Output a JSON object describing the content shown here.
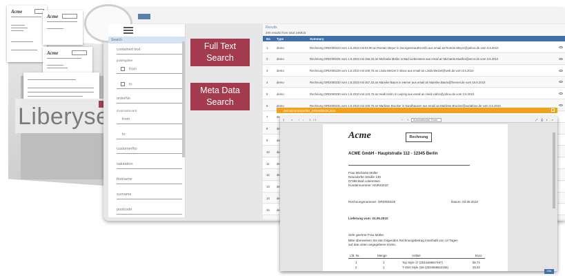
{
  "brand": {
    "name": "Liberyse"
  },
  "background_docs": {
    "logo": "Acme",
    "header_text": "ACME GmbH - Hauptstraße 112 - 12345 Berlin"
  },
  "sidebar": {
    "search_label": "Search",
    "fields": {
      "contained_text": "contained text",
      "postingdate": "postingdate",
      "from": "from",
      "to": "to",
      "orderNo": "orderNo",
      "invoiceamount": "invoiceamount",
      "amount_from": "from",
      "amount_to": "to",
      "customerNo": "customerNo",
      "salutation": "salutation",
      "firstname": "firstname",
      "surname": "surname",
      "postcode": "postcode"
    }
  },
  "labels": {
    "full_text": [
      "Full Text",
      "Search"
    ],
    "meta_data": [
      "Meta Data",
      "Search"
    ]
  },
  "results": {
    "title": "Results",
    "count_text": "200 results from total 246815",
    "columns": {
      "no": "No",
      "type": "Type",
      "summary": "Summary"
    },
    "rows": [
      {
        "no": "1",
        "type": "demo",
        "summary": "Rechnung ORD000223 vom 1.5.2010 mit 53,90 an Roman Meyer in Georgensraut/Hombi aus email an Roman.Meyer@yahoo.de vom 3.5.2010"
      },
      {
        "no": "2",
        "type": "demo",
        "summary": "Rechnung ORD000225 vom 1.5.2010 mit 156,32 an Michaela Müller in Bad Liebenstein aus email an Michaela.Mueller@arcor.de vom 3.5.2010"
      },
      {
        "no": "3",
        "type": "demo",
        "summary": "Rechnung ORD000229 vom 1.5.2010 mit 100,75 an Linda Wetzel in Bous aus email an Linda.Wetzel@web.de vom 3.5.2010"
      },
      {
        "no": "4",
        "type": "demo",
        "summary": "Rechnung ORD000233 vom 1.5.2010 mit 457,33 an Mareike Baum in Hemer aus email an Mareike.Baum@freenet.de vom 15.8.2010"
      },
      {
        "no": "5",
        "type": "demo",
        "summary": "Rechnung ORD000230 vom 1.5.2010 mit 143,75 an Heidi Hahn in Leipzig aus email an Heidi.Hahn@yahoo.de vom 3.5.2010"
      },
      {
        "no": "6",
        "type": "demo",
        "summary": "Rechnung ORD000231 vom 1.5.2010 mit 100,75 an Marliese Brucker in Sandhausen aus email an Marliese.Brucker@vodafone.de vom 3.5.2010"
      },
      {
        "no": "7",
        "type": "dem",
        "summary": ""
      },
      {
        "no": "8",
        "type": "dem",
        "summary": ""
      },
      {
        "no": "9",
        "type": "dem",
        "summary": ""
      },
      {
        "no": "10",
        "type": "dem",
        "summary": ""
      },
      {
        "no": "11",
        "type": "dem",
        "summary": ""
      },
      {
        "no": "12",
        "type": "dem",
        "summary": ""
      },
      {
        "no": "13",
        "type": "dem",
        "summary": ""
      },
      {
        "no": "14",
        "type": "dem",
        "summary": ""
      },
      {
        "no": "15",
        "type": "dem",
        "summary": ""
      }
    ]
  },
  "preview": {
    "filename": "demo|invoice|order_ORD000225.json",
    "toolbar": {
      "page": "1",
      "of": "/ 1",
      "zoom": "Automatischer Zoom"
    },
    "invoice": {
      "logo": "Acme",
      "doc_type": "Rechnung",
      "company": "ACME GmbH - Hauptstraße 112 - 12345 Berlin",
      "address": [
        "Frau Michaela Müller",
        "Neundorfer Straße 130",
        "07356 Bad Lobenstein",
        "Kundennummer: KNR42010"
      ],
      "invoice_number": "Rechnungsnummer: ORD000225",
      "invoice_date": "Datum: 03.05.2010",
      "delivery": "Lieferung vom: 01.05.2010",
      "greeting": [
        "Sehr geehrte Frau Müller,",
        "Bitte überweisen Sie den folgenden Rechnungsbetrag innerhalb von 14 Tagen",
        "auf das unten angegebene Konto."
      ],
      "table": {
        "headers": [
          "Lfd. Nr.",
          "Menge",
          "Artikel",
          "Euro"
        ],
        "rows": [
          [
            "1",
            "1",
            "Top Style 17 (2534469667497)",
            "58,74"
          ],
          [
            "2",
            "1",
            "T-Shirt Style 156 (2534569822165)",
            "29,33"
          ]
        ]
      }
    }
  },
  "footer": {
    "button": "Hilfe"
  }
}
